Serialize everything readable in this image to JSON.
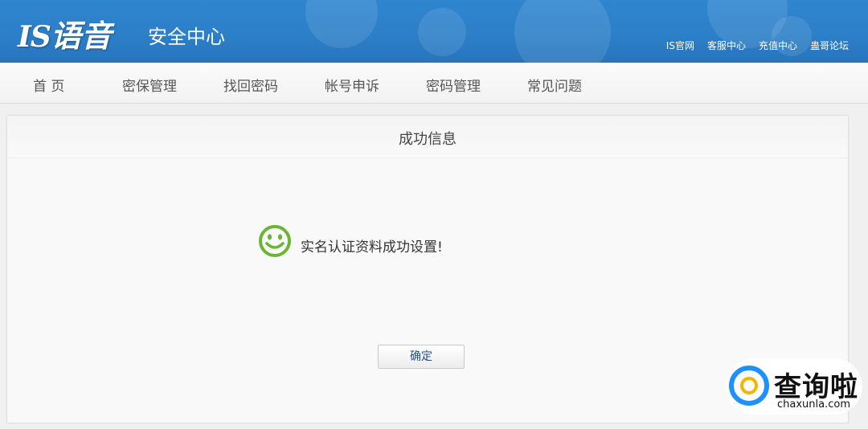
{
  "header": {
    "logo_is": "IS",
    "logo_yy": "语音",
    "subtitle": "安全中心",
    "links": [
      "IS官网",
      "客服中心",
      "充值中心",
      "蛊哥论坛"
    ]
  },
  "nav": {
    "items": [
      "首 页",
      "密保管理",
      "找回密码",
      "帐号申诉",
      "密码管理",
      "常见问题"
    ]
  },
  "panel": {
    "title": "成功信息",
    "message": "实名认证资料成功设置!",
    "ok_button": "确定"
  },
  "watermark": {
    "cn": "查询啦",
    "en": "chaxunla.com"
  },
  "colors": {
    "header_blue": "#2c7fc8",
    "smiley_green": "#6ab534",
    "button_text": "#1f4e87"
  }
}
